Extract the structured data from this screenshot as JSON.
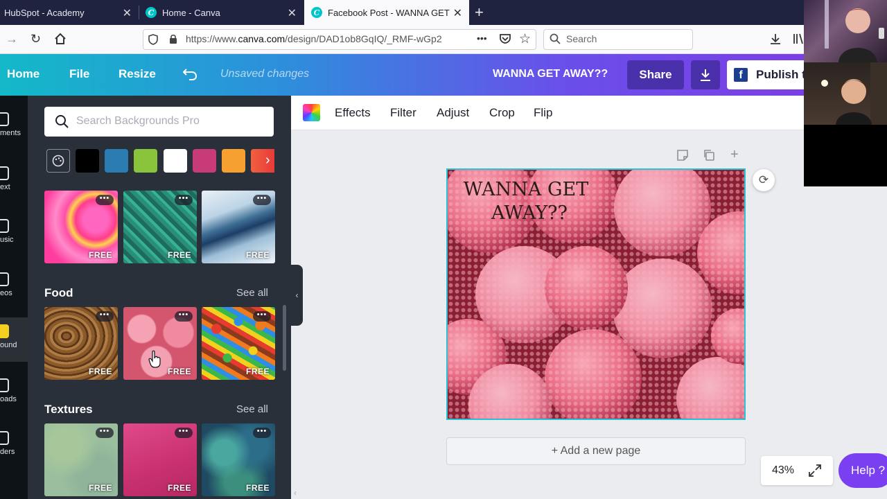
{
  "browser": {
    "tabs": [
      {
        "title": "HubSpot - Academy",
        "active": false
      },
      {
        "title": "Home - Canva",
        "active": false
      },
      {
        "title": "Facebook Post - WANNA GET A",
        "active": true
      }
    ],
    "new_tab_glyph": "+",
    "url_prefix": "https://www.",
    "url_domain": "canva.com",
    "url_path": "/design/DAD1ob8GqIQ/_RMF-wGp2",
    "search_placeholder": "Search",
    "url_actions_glyph": "•••"
  },
  "header": {
    "home": "Home",
    "file": "File",
    "resize": "Resize",
    "unsaved": "Unsaved changes",
    "doc_title": "WANNA GET AWAY??",
    "share": "Share",
    "publish": "Publish t"
  },
  "rail": [
    {
      "label": "ments",
      "icon": "elements-icon"
    },
    {
      "label": "ext",
      "icon": "text-icon"
    },
    {
      "label": "usic",
      "icon": "music-icon"
    },
    {
      "label": "eos",
      "icon": "videos-icon"
    },
    {
      "label": "ound",
      "icon": "background-icon",
      "active": true
    },
    {
      "label": "oads",
      "icon": "uploads-icon"
    },
    {
      "label": "ders",
      "icon": "folders-icon"
    }
  ],
  "panel": {
    "search_placeholder": "Search Backgrounds Pro",
    "swatches": [
      "#000000",
      "#2a7bb0",
      "#8ac43a",
      "#ffffff",
      "#c83a78",
      "#f5a030",
      "#f06040"
    ],
    "free_label": "FREE",
    "more_glyph": "•••",
    "sections": [
      {
        "title": "Food",
        "see_all": "See all"
      },
      {
        "title": "Textures",
        "see_all": "See all"
      }
    ]
  },
  "toolbar": {
    "effects": "Effects",
    "filter": "Filter",
    "adjust": "Adjust",
    "crop": "Crop",
    "flip": "Flip"
  },
  "canvas": {
    "design_text_line1": "WANNA GET",
    "design_text_line2": "AWAY??",
    "add_page": "+ Add a new page",
    "zoom": "43%",
    "help": "Help ?"
  },
  "colors": {
    "accent_teal": "#2bc3d2",
    "header_start": "#13b9c8",
    "header_end": "#7b3fe4",
    "panel_bg": "#293039",
    "help_purple": "#7a3ff0"
  }
}
